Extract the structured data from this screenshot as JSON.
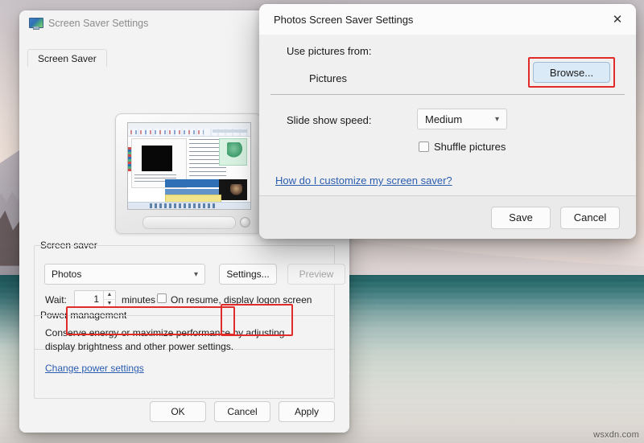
{
  "desktop": {
    "watermark": "wsxdn.com"
  },
  "screen_saver_window": {
    "title": "Screen Saver Settings",
    "icon": "display-monitor-icon",
    "tabs": [
      {
        "label": "Screen Saver",
        "selected": true
      }
    ],
    "screen_saver_group": {
      "label": "Screen saver",
      "selected_value": "Photos",
      "settings_button": "Settings...",
      "preview_button": "Preview",
      "preview_disabled": true,
      "wait_label": "Wait:",
      "wait_value": "1",
      "minutes_label": "minutes",
      "on_resume_label": "On resume, display logon screen",
      "on_resume_checked": false
    },
    "power_group": {
      "label": "Power management",
      "description": "Conserve energy or maximize performance by adjusting display brightness and other power settings.",
      "link": "Change power settings"
    },
    "footer_buttons": [
      {
        "label": "OK"
      },
      {
        "label": "Cancel"
      },
      {
        "label": "Apply"
      }
    ]
  },
  "photos_dialog": {
    "title": "Photos Screen Saver Settings",
    "close_icon": "close-icon",
    "use_pictures_label": "Use pictures from:",
    "pictures_value": "Pictures",
    "browse_button": "Browse...",
    "slide_show_speed_label": "Slide show speed:",
    "slide_show_speed_value": "Medium",
    "shuffle_label": "Shuffle pictures",
    "shuffle_checked": false,
    "help_link": "How do I customize my screen saver?",
    "footer_buttons": [
      {
        "label": "Save"
      },
      {
        "label": "Cancel"
      }
    ]
  },
  "annotations": {
    "highlight_color": "#e02b29",
    "highlighted": [
      "screen-saver-select",
      "settings-button",
      "browse-button"
    ]
  },
  "icons": {
    "chevron_down": "⌄",
    "spinner_up": "▲",
    "spinner_down": "▼",
    "close": "✕"
  }
}
